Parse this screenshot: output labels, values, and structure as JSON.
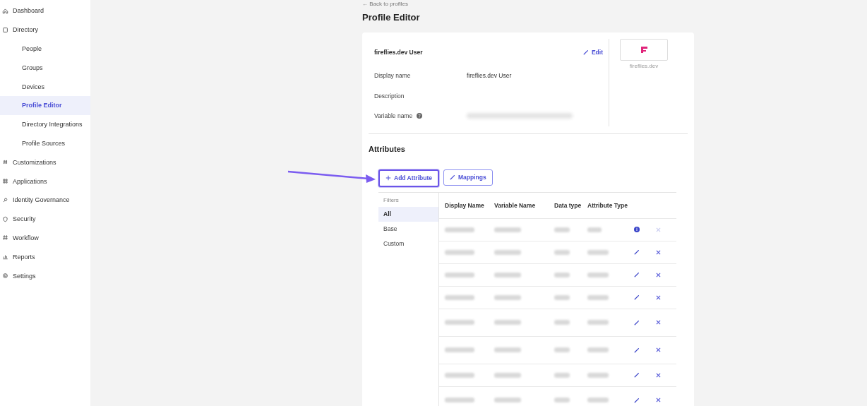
{
  "sidebar": {
    "items": [
      {
        "label": "Dashboard",
        "selected": false
      },
      {
        "label": "Directory",
        "selected": false,
        "children": [
          {
            "label": "People",
            "selected": false
          },
          {
            "label": "Groups",
            "selected": false
          },
          {
            "label": "Devices",
            "selected": false
          },
          {
            "label": "Profile Editor",
            "selected": true
          },
          {
            "label": "Directory Integrations",
            "selected": false
          },
          {
            "label": "Profile Sources",
            "selected": false
          }
        ]
      },
      {
        "label": "Customizations",
        "selected": false
      },
      {
        "label": "Applications",
        "selected": false
      },
      {
        "label": "Identity Governance",
        "selected": false
      },
      {
        "label": "Security",
        "selected": false
      },
      {
        "label": "Workflow",
        "selected": false
      },
      {
        "label": "Reports",
        "selected": false
      },
      {
        "label": "Settings",
        "selected": false
      }
    ]
  },
  "back_link": "← Back to profiles",
  "title": "Profile Editor",
  "profile": {
    "name": "fireflies.dev User",
    "edit": "Edit",
    "fields": [
      {
        "label": "Display name",
        "value": "fireflies.dev User",
        "redacted": false,
        "help": false
      },
      {
        "label": "Description",
        "redacted": false,
        "help": false
      },
      {
        "label": "Variable name",
        "redacted": true,
        "help": true
      }
    ],
    "app_label": "fireflies.dev"
  },
  "attributes": {
    "heading": "Attributes",
    "buttons": [
      {
        "label": "Add Attribute",
        "kind": "add",
        "highlighted": true
      },
      {
        "label": "Mappings",
        "kind": "edit",
        "highlighted": false
      }
    ],
    "filters": {
      "heading": "Filters",
      "items": [
        {
          "label": "All",
          "selected": true
        },
        {
          "label": "Base",
          "selected": false
        },
        {
          "label": "Custom",
          "selected": false
        }
      ]
    },
    "columns": [
      "Display Name",
      "Variable Name",
      "Data type",
      "Attribute Type"
    ],
    "rows": [
      {
        "kind": "info",
        "removable": false,
        "tall": false
      },
      {
        "kind": "edit",
        "removable": true,
        "tall": false
      },
      {
        "kind": "edit",
        "removable": true,
        "tall": false
      },
      {
        "kind": "edit",
        "removable": true,
        "tall": false
      },
      {
        "kind": "edit",
        "removable": true,
        "tall": true
      },
      {
        "kind": "edit",
        "removable": true,
        "tall": true
      },
      {
        "kind": "edit",
        "removable": true,
        "tall": false
      },
      {
        "kind": "edit",
        "removable": true,
        "tall": true
      }
    ]
  }
}
